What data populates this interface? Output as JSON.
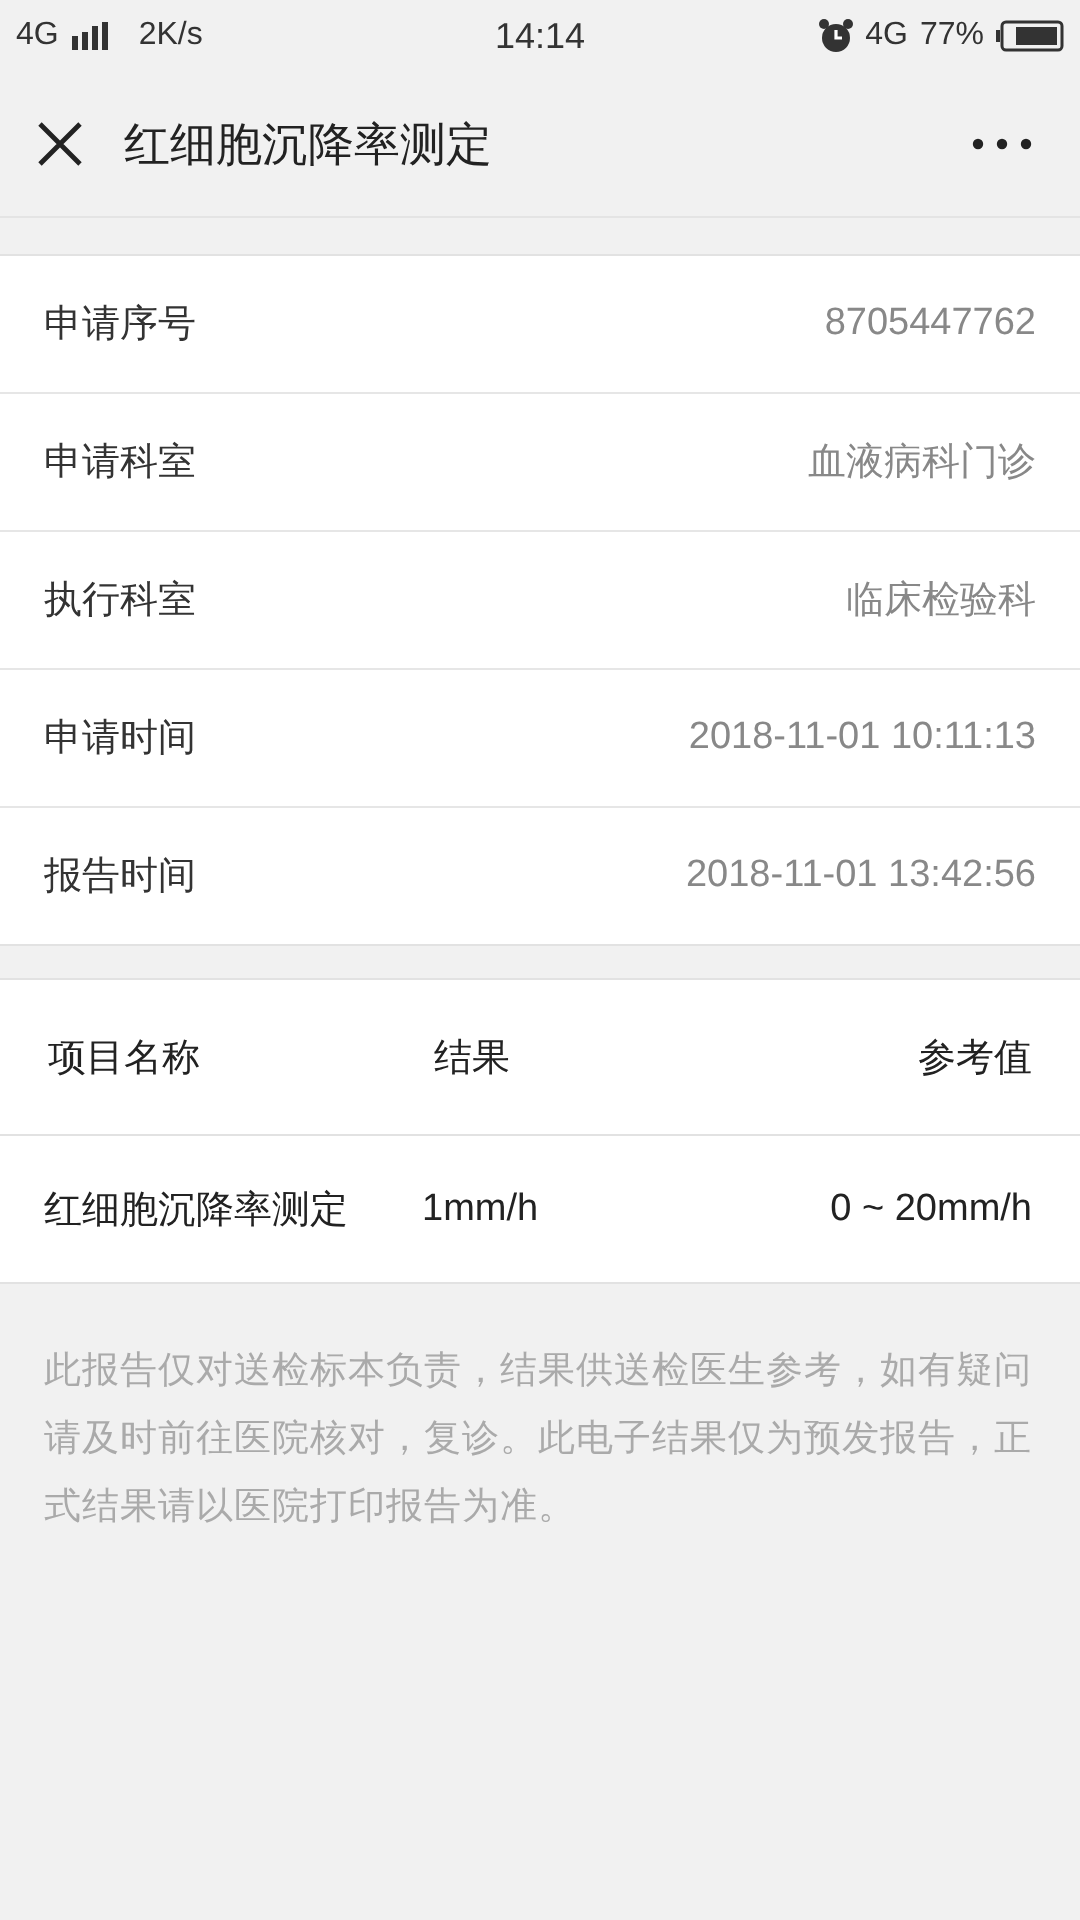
{
  "status_bar": {
    "network": "4G",
    "speed": "2K/s",
    "time": "14:14",
    "network_right": "4G",
    "battery": "77%"
  },
  "header": {
    "title": "红细胞沉降率测定"
  },
  "info": [
    {
      "label": "申请序号",
      "value": "8705447762"
    },
    {
      "label": "申请科室",
      "value": "血液病科门诊"
    },
    {
      "label": "执行科室",
      "value": "临床检验科"
    },
    {
      "label": "申请时间",
      "value": "2018-11-01 10:11:13"
    },
    {
      "label": "报告时间",
      "value": "2018-11-01 13:42:56"
    }
  ],
  "table": {
    "columns": [
      "项目名称",
      "结果",
      "参考值"
    ],
    "rows": [
      [
        "红细胞沉降率测定",
        "1mm/h",
        "0 ~ 20mm/h"
      ]
    ]
  },
  "note": "此报告仅对送检标本负责，结果供送检医生参考，如有疑问请及时前往医院核对，复诊。此电子结果仅为预发报告，正式结果请以医院打印报告为准。"
}
